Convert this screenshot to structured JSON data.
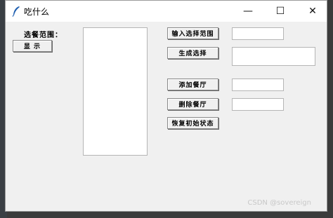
{
  "window": {
    "title": "吃什么",
    "controls": {
      "minimize": "—",
      "maximize": "☐",
      "close": "✕"
    }
  },
  "left": {
    "range_label": "选餐范围：",
    "show_button": "显 示"
  },
  "right": {
    "input_range_button": "输入选择范围",
    "generate_button": "生成选择",
    "add_button": "添加餐厅",
    "delete_button": "删除餐厅",
    "restore_button": "恢复初始状态"
  },
  "watermark": "CSDN @sovereign"
}
